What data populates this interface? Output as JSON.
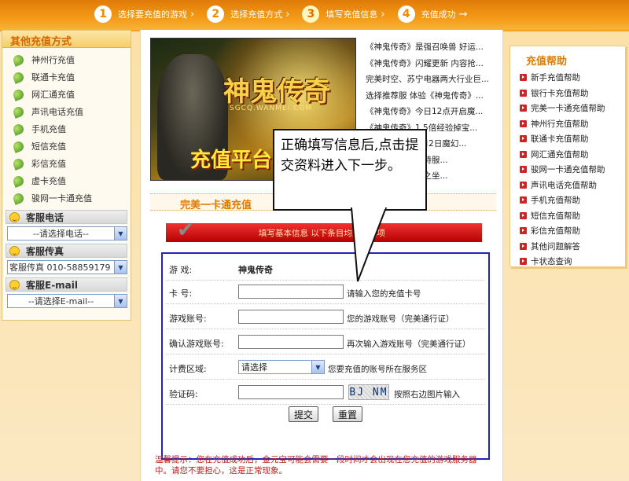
{
  "steps": [
    {
      "num": "1",
      "label": "选择要充值的游戏"
    },
    {
      "num": "2",
      "label": "选择充值方式"
    },
    {
      "num": "3",
      "label": "填写充值信息"
    },
    {
      "num": "4",
      "label": "充值成功"
    }
  ],
  "sidebar": {
    "title": "其他充值方式",
    "items": [
      "神州行充值",
      "联通卡充值",
      "网汇通充值",
      "声讯电话充值",
      "手机充值",
      "短信充值",
      "彩信充值",
      "虚卡充值",
      "骏网一卡通充值"
    ],
    "phone": {
      "title": "客服电话",
      "value": "--请选择电话--"
    },
    "fax": {
      "title": "客服传真",
      "value": "客服传真 010-58859179"
    },
    "email": {
      "title": "客服E-mail",
      "value": "--请选择E-mail--"
    }
  },
  "banner": {
    "logo": "神鬼传奇",
    "logo_sub": "SGCQ.WANMEI.COM",
    "promo": "充值平台"
  },
  "news": [
    "《神鬼传奇》是强召唤兽 好运...",
    "《神鬼传奇》闪耀更新 内容抢...",
    "完美时空、苏宁电器两大行业巨...",
    "选择推荐服 体验《神鬼传奇》...",
    "《神鬼传奇》今日12点开启魔...",
    "《神鬼传奇》1.5倍经验掉宝...",
    "《神鬼传奇》4月2日魔幻...",
    "《神鬼传奇》哥特服...",
    "《神鬼传奇》神之坐..."
  ],
  "product_title": "完美一卡通充值",
  "form_banner": "填写基本信息  以下条目均为必填项",
  "form": {
    "game_label": "游 戏:",
    "game_value": "神鬼传奇",
    "card_label": "卡 号:",
    "card_hint": "请输入您的充值卡号",
    "account_label": "游戏账号:",
    "account_hint": "您的游戏账号（完美通行证）",
    "confirm_label": "确认游戏账号:",
    "confirm_hint": "再次输入游戏账号（完美通行证）",
    "zone_label": "计费区域:",
    "zone_value": "请选择",
    "zone_hint": "您要充值的账号所在服务区",
    "captcha_label": "验证码:",
    "captcha_text": "BJ NM",
    "captcha_hint": "按照右边图片输入",
    "submit": "提交",
    "reset": "重置"
  },
  "tip": "温馨提示：您在充值成功后，金元宝可能会需要一段时间才会出现在您充值的游戏服务器中。请您不要担心，这是正常现象。",
  "callout": "正确填写信息后,点击提交资料进入下一步。",
  "help": {
    "title": "充值帮助",
    "items": [
      "新手充值帮助",
      "银行卡充值帮助",
      "完美一卡通充值帮助",
      "神州行充值帮助",
      "联通卡充值帮助",
      "网汇通充值帮助",
      "骏网一卡通充值帮助",
      "声讯电话充值帮助",
      "手机充值帮助",
      "短信充值帮助",
      "彩信充值帮助",
      "其他问题解答",
      "卡状态查询"
    ]
  },
  "colors": {
    "accent": "#f08a00",
    "form_border": "#2424b8",
    "banner_red": "#c00000",
    "tip_red": "#c02222"
  }
}
